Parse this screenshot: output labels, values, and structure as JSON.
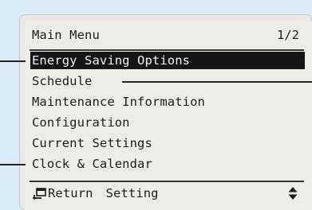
{
  "menu": {
    "title": "Main Menu",
    "page": "1/2",
    "items": [
      {
        "label": "Energy Saving Options",
        "selected": true
      },
      {
        "label": "Schedule",
        "selected": false
      },
      {
        "label": "Maintenance Information",
        "selected": false
      },
      {
        "label": "Configuration",
        "selected": false
      },
      {
        "label": "Current Settings",
        "selected": false
      },
      {
        "label": "Clock & Calendar",
        "selected": false
      }
    ]
  },
  "footer": {
    "return_label": "Return",
    "setting_label": "Setting",
    "return_icon": "return-arrow-icon",
    "scroll_icon": "up-down-arrows-icon"
  },
  "colors": {
    "background": "#dcecf7",
    "screen": "#ecece9",
    "highlight": "#151515",
    "text": "#1e1e1e"
  }
}
